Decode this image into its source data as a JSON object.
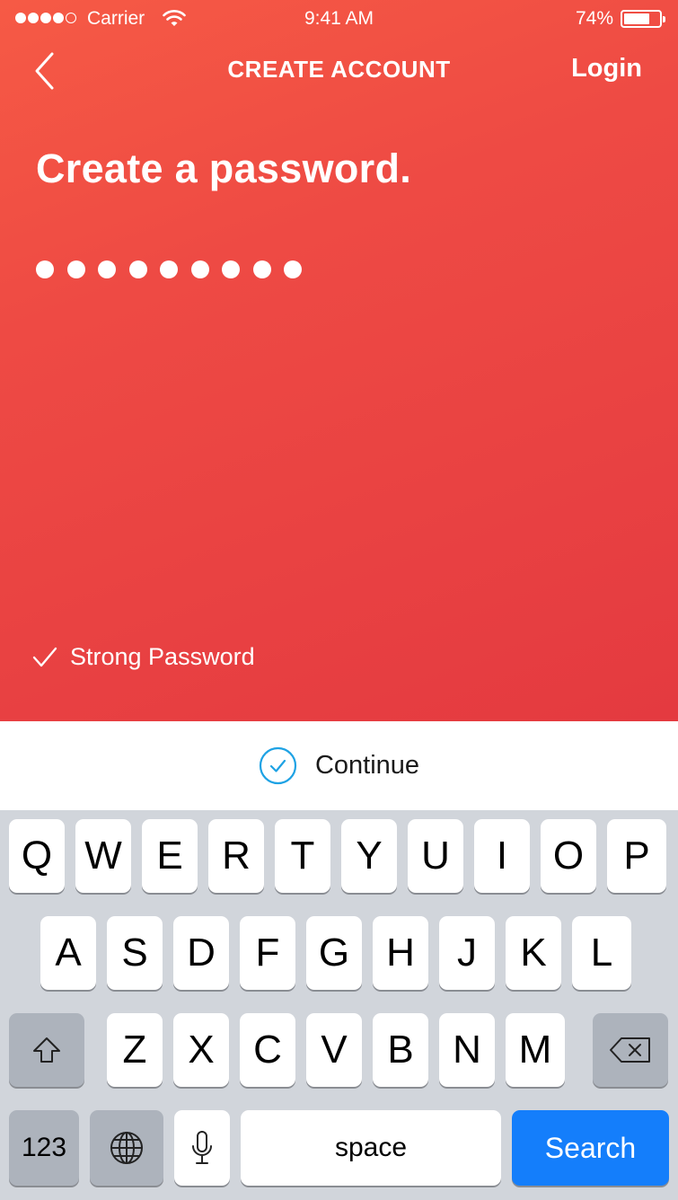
{
  "status_bar": {
    "carrier": "Carrier",
    "time": "9:41 AM",
    "battery": "74%",
    "battery_level": 0.74
  },
  "nav": {
    "title": "CREATE ACCOUNT",
    "login_label": "Login"
  },
  "form": {
    "heading": "Create a password.",
    "password_masked_length": 9,
    "strength_label": "Strong Password"
  },
  "continue_label": "Continue",
  "keyboard": {
    "row1": [
      "Q",
      "W",
      "E",
      "R",
      "T",
      "Y",
      "U",
      "I",
      "O",
      "P"
    ],
    "row2": [
      "A",
      "S",
      "D",
      "F",
      "G",
      "H",
      "J",
      "K",
      "L"
    ],
    "row3": [
      "Z",
      "X",
      "C",
      "V",
      "B",
      "N",
      "M"
    ],
    "numbers_label": "123",
    "space_label": "space",
    "search_label": "Search"
  },
  "colors": {
    "accent": "#ee4a44",
    "keyboard_action": "#147efb",
    "continue_icon": "#1ea2e4"
  }
}
